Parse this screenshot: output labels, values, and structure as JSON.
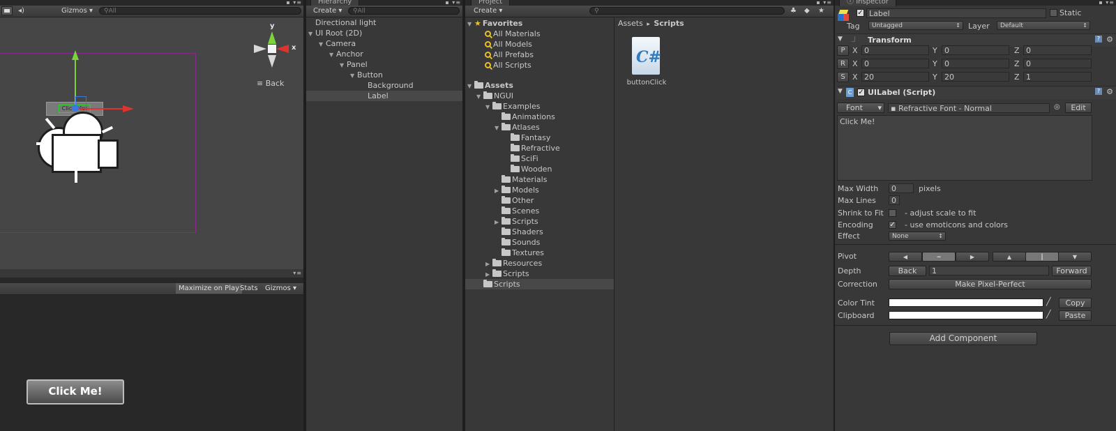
{
  "scene": {
    "toolbar": {
      "gizmos": "Gizmos",
      "search_placeholder": "All"
    },
    "gizmo_axes": {
      "y": "y",
      "x": "x"
    },
    "back_label": "Back",
    "widget_label": "Click Me!"
  },
  "game": {
    "maximize": "Maximize on Play",
    "stats": "Stats",
    "gizmos": "Gizmos",
    "button_label": "Click Me!"
  },
  "hierarchy": {
    "tab": "Hierarchy",
    "create": "Create",
    "search_placeholder": "All",
    "items": [
      {
        "label": "Directional light",
        "depth": 0,
        "expanded": null,
        "selected": false
      },
      {
        "label": "UI Root (2D)",
        "depth": 0,
        "expanded": true,
        "selected": false
      },
      {
        "label": "Camera",
        "depth": 1,
        "expanded": true,
        "selected": false
      },
      {
        "label": "Anchor",
        "depth": 2,
        "expanded": true,
        "selected": false
      },
      {
        "label": "Panel",
        "depth": 3,
        "expanded": true,
        "selected": false
      },
      {
        "label": "Button",
        "depth": 4,
        "expanded": true,
        "selected": false
      },
      {
        "label": "Background",
        "depth": 5,
        "expanded": null,
        "selected": false
      },
      {
        "label": "Label",
        "depth": 5,
        "expanded": null,
        "selected": true
      }
    ]
  },
  "project": {
    "tab": "Project",
    "create": "Create",
    "favorites": {
      "title": "Favorites",
      "items": [
        "All Materials",
        "All Models",
        "All Prefabs",
        "All Scripts"
      ]
    },
    "assets_title": "Assets",
    "tree": [
      {
        "label": "NGUI",
        "depth": 1,
        "expanded": true
      },
      {
        "label": "Examples",
        "depth": 2,
        "expanded": true
      },
      {
        "label": "Animations",
        "depth": 3,
        "expanded": null
      },
      {
        "label": "Atlases",
        "depth": 3,
        "expanded": true
      },
      {
        "label": "Fantasy",
        "depth": 4,
        "expanded": null
      },
      {
        "label": "Refractive",
        "depth": 4,
        "expanded": null
      },
      {
        "label": "SciFi",
        "depth": 4,
        "expanded": null
      },
      {
        "label": "Wooden",
        "depth": 4,
        "expanded": null
      },
      {
        "label": "Materials",
        "depth": 3,
        "expanded": null
      },
      {
        "label": "Models",
        "depth": 3,
        "expanded": false
      },
      {
        "label": "Other",
        "depth": 3,
        "expanded": null
      },
      {
        "label": "Scenes",
        "depth": 3,
        "expanded": null
      },
      {
        "label": "Scripts",
        "depth": 3,
        "expanded": false
      },
      {
        "label": "Shaders",
        "depth": 3,
        "expanded": null
      },
      {
        "label": "Sounds",
        "depth": 3,
        "expanded": null
      },
      {
        "label": "Textures",
        "depth": 3,
        "expanded": null
      },
      {
        "label": "Resources",
        "depth": 2,
        "expanded": false
      },
      {
        "label": "Scripts",
        "depth": 2,
        "expanded": false
      },
      {
        "label": "Scripts",
        "depth": 1,
        "expanded": null,
        "selected": true
      }
    ],
    "breadcrumb": {
      "root": "Assets",
      "separator": "▸",
      "current": "Scripts"
    },
    "file": {
      "icon_text": "C#",
      "name": "buttonClick"
    }
  },
  "inspector": {
    "tab": "Inspector",
    "object_name": "Label",
    "static_label": "Static",
    "tag_label": "Tag",
    "tag_value": "Untagged",
    "layer_label": "Layer",
    "layer_value": "Default",
    "transform": {
      "title": "Transform",
      "rows": [
        {
          "btn": "P",
          "x": "0",
          "y": "0",
          "z": "0"
        },
        {
          "btn": "R",
          "x": "0",
          "y": "0",
          "z": "0"
        },
        {
          "btn": "S",
          "x": "20",
          "y": "20",
          "z": "1"
        }
      ],
      "axis_x": "X",
      "axis_y": "Y",
      "axis_z": "Z"
    },
    "uilabel": {
      "title": "UILabel (Script)",
      "font_button": "Font",
      "font_value": "Refractive Font - Normal",
      "edit": "Edit",
      "text": "Click Me!",
      "max_width_label": "Max Width",
      "max_width_value": "0",
      "max_width_unit": "pixels",
      "max_lines_label": "Max Lines",
      "max_lines_value": "0",
      "shrink_label": "Shrink to Fit",
      "shrink_hint": "- adjust scale to fit",
      "encoding_label": "Encoding",
      "encoding_hint": "- use emoticons and colors",
      "effect_label": "Effect",
      "effect_value": "None",
      "pivot_label": "Pivot",
      "depth_label": "Depth",
      "depth_back": "Back",
      "depth_value": "1",
      "depth_forward": "Forward",
      "correction_label": "Correction",
      "pixel_perfect": "Make Pixel-Perfect",
      "color_tint_label": "Color Tint",
      "copy": "Copy",
      "clipboard_label": "Clipboard",
      "paste": "Paste"
    },
    "add_component": "Add Component",
    "colors": {
      "tint": "#ffffff",
      "clipboard": "#ffffff"
    }
  },
  "colors": {
    "panel_bg": "#383838",
    "game_bg": "#282828",
    "selection": "#484848",
    "gizmo_red": "#e0332f",
    "gizmo_green": "#7cd43a",
    "gizmo_blue": "#3a78e0",
    "ui_root_outline": "#8a2a8a",
    "folder_yellow": "#e8c12b"
  }
}
